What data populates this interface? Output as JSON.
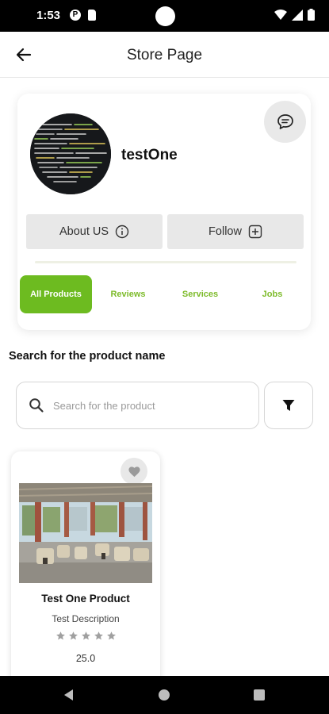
{
  "status_bar": {
    "time": "1:53",
    "notification_glyph": "P"
  },
  "app_bar": {
    "title": "Store Page",
    "back_icon": "arrow-left-icon"
  },
  "store": {
    "name": "testOne",
    "about_label": "About US",
    "follow_label": "Follow",
    "chat_icon": "chat-bubble-icon"
  },
  "tabs": [
    {
      "label": "All Products",
      "active": true
    },
    {
      "label": "Reviews",
      "active": false
    },
    {
      "label": "Services",
      "active": false
    },
    {
      "label": "Jobs",
      "active": false
    }
  ],
  "search": {
    "section_label": "Search for the product name",
    "placeholder": "Search for the product",
    "value": ""
  },
  "products": [
    {
      "name": "Test One Product",
      "description": "Test Description",
      "rating": 0,
      "rating_max": 5,
      "price": "25.0"
    }
  ],
  "colors": {
    "accent_green": "#6dbb20",
    "tab_text_green": "#7dbb2a",
    "button_gray": "#e8e8e8"
  }
}
